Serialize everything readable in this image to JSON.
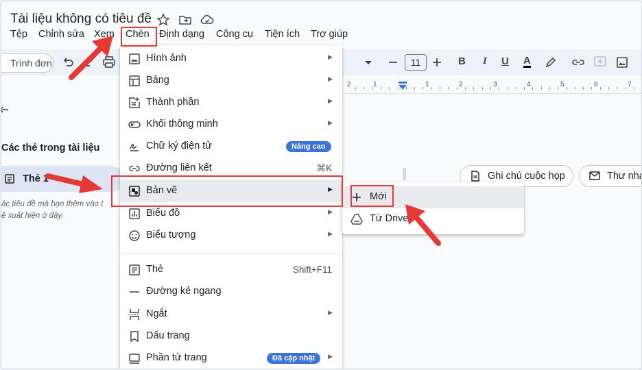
{
  "document": {
    "title": "Tài liệu không có tiêu đề"
  },
  "menubar": [
    "Tệp",
    "Chỉnh sửa",
    "Xem",
    "Chèn",
    "Định dạng",
    "Công cụ",
    "Tiện ích",
    "Trợ giúp"
  ],
  "toolbar": {
    "search_label": "Trình đơn",
    "font_size": "11",
    "bold": "B",
    "italic": "I",
    "underline": "U",
    "text_color": "A"
  },
  "ruler": {
    "numbers": [
      "2",
      "1",
      "1",
      "2",
      "3",
      "4",
      "5",
      "6",
      "7"
    ]
  },
  "sidebar": {
    "section_title": "Các thẻ trong tài liệu",
    "tab_name": "Thẻ 1",
    "hint_line1": "ác tiêu đề mà bạn thêm vào t",
    "hint_line2": "ẽ xuất hiện ở đây."
  },
  "chips": {
    "meeting_notes": "Ghi chú cuộc họp",
    "email_draft": "Thư nhá"
  },
  "insert_menu": {
    "items": [
      {
        "label": "Hình ảnh",
        "icon": "image-icon",
        "submenu": true
      },
      {
        "label": "Bảng",
        "icon": "table-icon",
        "submenu": true
      },
      {
        "label": "Thành phần",
        "icon": "building-blocks-icon",
        "submenu": true
      },
      {
        "label": "Khối thông minh",
        "icon": "smart-chips-icon",
        "submenu": true
      },
      {
        "label": "Chữ ký điện tử",
        "icon": "signature-icon",
        "badge": "Nâng cao"
      },
      {
        "label": "Đường liên kết",
        "icon": "link-icon",
        "shortcut": "⌘K"
      },
      {
        "label": "Bản vẽ",
        "icon": "drawing-icon",
        "submenu": true,
        "highlighted": true
      },
      {
        "label": "Biểu đồ",
        "icon": "chart-icon",
        "submenu": true
      },
      {
        "label": "Biểu tượng",
        "icon": "emoji-icon",
        "submenu": true
      },
      {
        "label": "Thẻ",
        "icon": "doc-tab-icon",
        "shortcut": "Shift+F11"
      },
      {
        "label": "Đường kẻ ngang",
        "icon": "horizontal-line-icon"
      },
      {
        "label": "Ngắt",
        "icon": "break-icon",
        "submenu": true
      },
      {
        "label": "Dấu trang",
        "icon": "bookmark-icon"
      },
      {
        "label": "Phần tử trang",
        "icon": "page-elements-icon",
        "badge": "Đã cập nhật",
        "submenu": true
      }
    ]
  },
  "drawing_submenu": {
    "items": [
      {
        "label": "Mới",
        "icon": "plus-icon",
        "highlighted": true
      },
      {
        "label": "Từ Drive",
        "icon": "drive-icon"
      }
    ]
  },
  "colors": {
    "accent": "#3b73d9",
    "highlight": "#e53935",
    "menu_hover": "#e8eaed",
    "ruler_marker": "#3b73d9"
  }
}
